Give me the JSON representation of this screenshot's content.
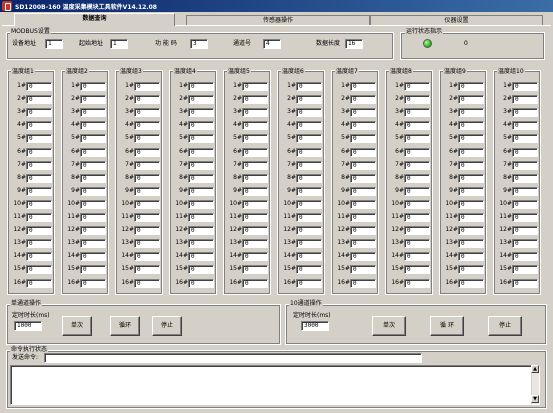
{
  "window": {
    "title": "SD1200B-160 温度采集模块工具软件V14.12.08"
  },
  "tabs": [
    {
      "label": "数据查询",
      "active": true
    },
    {
      "label": "传感器操作",
      "active": false
    },
    {
      "label": "仪器设置",
      "active": false
    }
  ],
  "modbus": {
    "title": "MODBUS设置",
    "device_addr_label": "设备地址",
    "device_addr": "1",
    "start_addr_label": "起始地址",
    "start_addr": "1",
    "func_code_label": "功 能 码",
    "func_code": "3",
    "channel_label": "通道号",
    "channel": "4",
    "data_len_label": "数据长度",
    "data_len": "16"
  },
  "status_indicator": {
    "title": "运行状态指示",
    "value": "0",
    "led_color": "#22c21a"
  },
  "temp_groups": {
    "rows": [
      "1#",
      "2#",
      "3#",
      "4#",
      "5#",
      "6#",
      "7#",
      "8#",
      "9#",
      "10#",
      "11#",
      "12#",
      "13#",
      "14#",
      "15#",
      "16#"
    ],
    "items": [
      {
        "title": "温度组1",
        "values": [
          "0",
          "0",
          "0",
          "0",
          "0",
          "0",
          "0",
          "0",
          "0",
          "0",
          "0",
          "0",
          "0",
          "0",
          "0",
          "0"
        ]
      },
      {
        "title": "温度组2",
        "values": [
          "0",
          "0",
          "0",
          "0",
          "0",
          "0",
          "0",
          "0",
          "0",
          "0",
          "0",
          "0",
          "0",
          "0",
          "0",
          "0"
        ]
      },
      {
        "title": "温度组3",
        "values": [
          "0",
          "0",
          "0",
          "0",
          "0",
          "0",
          "0",
          "0",
          "0",
          "0",
          "0",
          "0",
          "0",
          "0",
          "0",
          "0"
        ]
      },
      {
        "title": "温度组4",
        "values": [
          "0",
          "0",
          "0",
          "0",
          "0",
          "0",
          "0",
          "0",
          "0",
          "0",
          "0",
          "0",
          "0",
          "0",
          "0",
          "0"
        ]
      },
      {
        "title": "温度组5",
        "values": [
          "0",
          "0",
          "0",
          "0",
          "0",
          "0",
          "0",
          "0",
          "0",
          "0",
          "0",
          "0",
          "0",
          "0",
          "0",
          "0"
        ]
      },
      {
        "title": "温度组6",
        "values": [
          "0",
          "0",
          "0",
          "0",
          "0",
          "0",
          "0",
          "0",
          "0",
          "0",
          "0",
          "0",
          "0",
          "0",
          "0",
          "0"
        ]
      },
      {
        "title": "温度组7",
        "values": [
          "0",
          "0",
          "0",
          "0",
          "0",
          "0",
          "0",
          "0",
          "0",
          "0",
          "0",
          "0",
          "0",
          "0",
          "0",
          "0"
        ]
      },
      {
        "title": "温度组8",
        "values": [
          "0",
          "0",
          "0",
          "0",
          "0",
          "0",
          "0",
          "0",
          "0",
          "0",
          "0",
          "0",
          "0",
          "0",
          "0",
          "0"
        ]
      },
      {
        "title": "温度组9",
        "values": [
          "0",
          "0",
          "0",
          "0",
          "0",
          "0",
          "0",
          "0",
          "0",
          "0",
          "0",
          "0",
          "0",
          "0",
          "0",
          "0"
        ]
      },
      {
        "title": "温度组10",
        "values": [
          "0",
          "0",
          "0",
          "0",
          "0",
          "0",
          "0",
          "0",
          "0",
          "0",
          "0",
          "0",
          "0",
          "0",
          "0",
          "0"
        ]
      }
    ]
  },
  "single_op": {
    "title": "单通道操作",
    "timer_label": "定时时长(ms)",
    "timer_value": "1000",
    "once_label": "单次",
    "loop_label": "循环",
    "stop_label": "停止"
  },
  "ten_op": {
    "title": "10通道操作",
    "timer_label": "定时时长(ms)",
    "timer_value": "3000",
    "once_label": "单次",
    "loop_label": "循 环",
    "stop_label": "停止"
  },
  "command": {
    "title": "命令执行状态",
    "send_label": "发送命令:",
    "send_value": "",
    "log_value": ""
  }
}
